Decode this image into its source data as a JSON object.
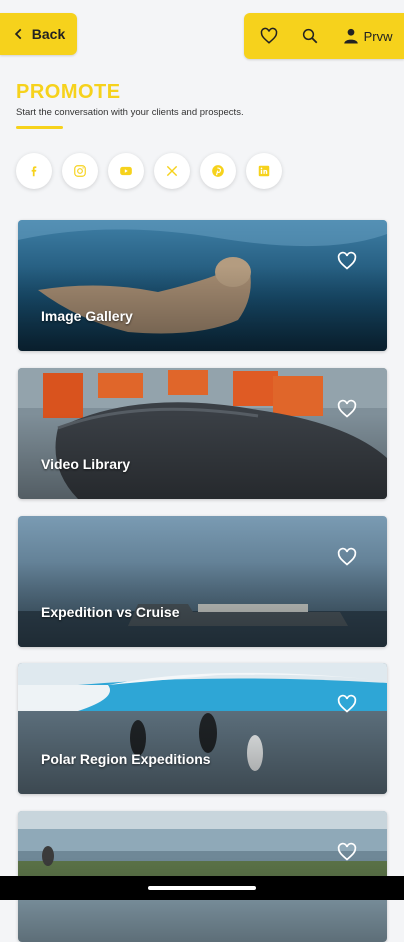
{
  "header": {
    "back_label": "Back",
    "profile_label": "Prvw"
  },
  "page": {
    "title": "PROMOTE",
    "subtitle": "Start the conversation with your clients and prospects."
  },
  "socials": [
    "facebook-icon",
    "instagram-icon",
    "youtube-icon",
    "x-icon",
    "pinterest-icon",
    "linkedin-icon"
  ],
  "cards": [
    {
      "label": "Image Gallery"
    },
    {
      "label": "Video Library"
    },
    {
      "label": "Expedition vs Cruise"
    },
    {
      "label": "Polar Region Expeditions"
    },
    {
      "label": ""
    }
  ],
  "colors": {
    "accent": "#f6d21c",
    "background": "#f4f5f7"
  }
}
